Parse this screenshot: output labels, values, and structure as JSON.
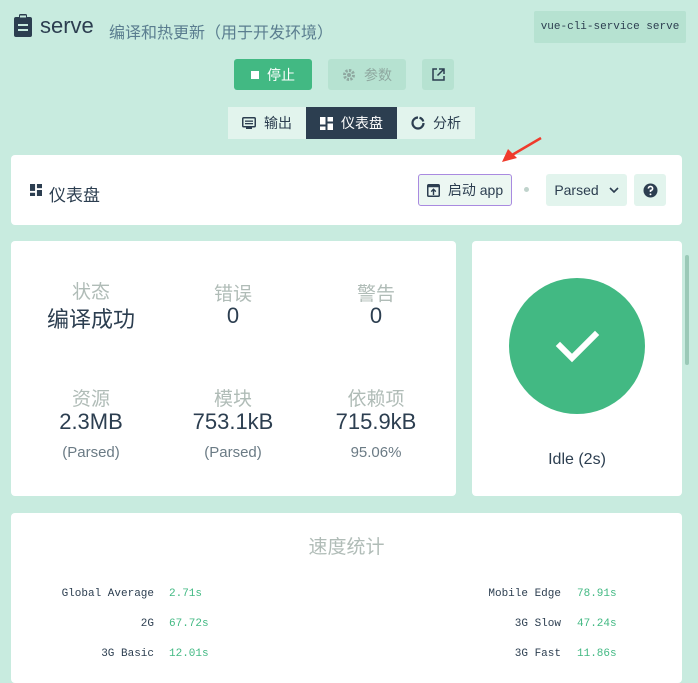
{
  "header": {
    "title": "serve",
    "subtitle": "编译和热更新（用于开发环境）",
    "command": "vue-cli-service serve"
  },
  "actions": {
    "stop_label": "停止",
    "params_label": "参数"
  },
  "tabs": [
    {
      "label": "输出",
      "icon": "terminal-icon",
      "active": false
    },
    {
      "label": "仪表盘",
      "icon": "dashboard-icon",
      "active": true
    },
    {
      "label": "分析",
      "icon": "donut-icon",
      "active": false
    }
  ],
  "dashboard": {
    "title": "仪表盘",
    "launch_label": "启动 app",
    "mode_value": "Parsed"
  },
  "stats": {
    "status": {
      "label": "状态",
      "value": "编译成功"
    },
    "errors": {
      "label": "错误",
      "value": "0"
    },
    "warnings": {
      "label": "警告",
      "value": "0"
    },
    "assets": {
      "label": "资源",
      "value": "2.3MB",
      "sub": "(Parsed)"
    },
    "modules": {
      "label": "模块",
      "value": "753.1kB",
      "sub": "(Parsed)"
    },
    "deps": {
      "label": "依赖项",
      "value": "715.9kB",
      "sub": "95.06%"
    }
  },
  "status_panel": {
    "text": "Idle (2s)",
    "color": "#42b983"
  },
  "speed": {
    "title": "速度统计",
    "left": [
      {
        "label": "Global Average",
        "value": "2.71s"
      },
      {
        "label": "2G",
        "value": "67.72s"
      },
      {
        "label": "3G Basic",
        "value": "12.01s"
      }
    ],
    "right": [
      {
        "label": "Mobile Edge",
        "value": "78.91s"
      },
      {
        "label": "3G Slow",
        "value": "47.24s"
      },
      {
        "label": "3G Fast",
        "value": "11.86s"
      }
    ]
  }
}
